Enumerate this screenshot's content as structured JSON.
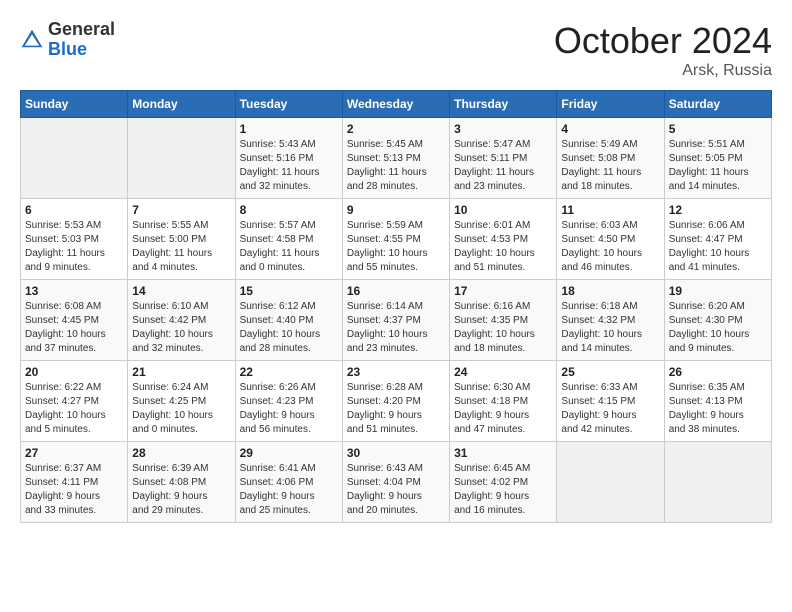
{
  "header": {
    "logo_general": "General",
    "logo_blue": "Blue",
    "month": "October 2024",
    "location": "Arsk, Russia"
  },
  "weekdays": [
    "Sunday",
    "Monday",
    "Tuesday",
    "Wednesday",
    "Thursday",
    "Friday",
    "Saturday"
  ],
  "weeks": [
    [
      {
        "day": "",
        "detail": ""
      },
      {
        "day": "",
        "detail": ""
      },
      {
        "day": "1",
        "detail": "Sunrise: 5:43 AM\nSunset: 5:16 PM\nDaylight: 11 hours\nand 32 minutes."
      },
      {
        "day": "2",
        "detail": "Sunrise: 5:45 AM\nSunset: 5:13 PM\nDaylight: 11 hours\nand 28 minutes."
      },
      {
        "day": "3",
        "detail": "Sunrise: 5:47 AM\nSunset: 5:11 PM\nDaylight: 11 hours\nand 23 minutes."
      },
      {
        "day": "4",
        "detail": "Sunrise: 5:49 AM\nSunset: 5:08 PM\nDaylight: 11 hours\nand 18 minutes."
      },
      {
        "day": "5",
        "detail": "Sunrise: 5:51 AM\nSunset: 5:05 PM\nDaylight: 11 hours\nand 14 minutes."
      }
    ],
    [
      {
        "day": "6",
        "detail": "Sunrise: 5:53 AM\nSunset: 5:03 PM\nDaylight: 11 hours\nand 9 minutes."
      },
      {
        "day": "7",
        "detail": "Sunrise: 5:55 AM\nSunset: 5:00 PM\nDaylight: 11 hours\nand 4 minutes."
      },
      {
        "day": "8",
        "detail": "Sunrise: 5:57 AM\nSunset: 4:58 PM\nDaylight: 11 hours\nand 0 minutes."
      },
      {
        "day": "9",
        "detail": "Sunrise: 5:59 AM\nSunset: 4:55 PM\nDaylight: 10 hours\nand 55 minutes."
      },
      {
        "day": "10",
        "detail": "Sunrise: 6:01 AM\nSunset: 4:53 PM\nDaylight: 10 hours\nand 51 minutes."
      },
      {
        "day": "11",
        "detail": "Sunrise: 6:03 AM\nSunset: 4:50 PM\nDaylight: 10 hours\nand 46 minutes."
      },
      {
        "day": "12",
        "detail": "Sunrise: 6:06 AM\nSunset: 4:47 PM\nDaylight: 10 hours\nand 41 minutes."
      }
    ],
    [
      {
        "day": "13",
        "detail": "Sunrise: 6:08 AM\nSunset: 4:45 PM\nDaylight: 10 hours\nand 37 minutes."
      },
      {
        "day": "14",
        "detail": "Sunrise: 6:10 AM\nSunset: 4:42 PM\nDaylight: 10 hours\nand 32 minutes."
      },
      {
        "day": "15",
        "detail": "Sunrise: 6:12 AM\nSunset: 4:40 PM\nDaylight: 10 hours\nand 28 minutes."
      },
      {
        "day": "16",
        "detail": "Sunrise: 6:14 AM\nSunset: 4:37 PM\nDaylight: 10 hours\nand 23 minutes."
      },
      {
        "day": "17",
        "detail": "Sunrise: 6:16 AM\nSunset: 4:35 PM\nDaylight: 10 hours\nand 18 minutes."
      },
      {
        "day": "18",
        "detail": "Sunrise: 6:18 AM\nSunset: 4:32 PM\nDaylight: 10 hours\nand 14 minutes."
      },
      {
        "day": "19",
        "detail": "Sunrise: 6:20 AM\nSunset: 4:30 PM\nDaylight: 10 hours\nand 9 minutes."
      }
    ],
    [
      {
        "day": "20",
        "detail": "Sunrise: 6:22 AM\nSunset: 4:27 PM\nDaylight: 10 hours\nand 5 minutes."
      },
      {
        "day": "21",
        "detail": "Sunrise: 6:24 AM\nSunset: 4:25 PM\nDaylight: 10 hours\nand 0 minutes."
      },
      {
        "day": "22",
        "detail": "Sunrise: 6:26 AM\nSunset: 4:23 PM\nDaylight: 9 hours\nand 56 minutes."
      },
      {
        "day": "23",
        "detail": "Sunrise: 6:28 AM\nSunset: 4:20 PM\nDaylight: 9 hours\nand 51 minutes."
      },
      {
        "day": "24",
        "detail": "Sunrise: 6:30 AM\nSunset: 4:18 PM\nDaylight: 9 hours\nand 47 minutes."
      },
      {
        "day": "25",
        "detail": "Sunrise: 6:33 AM\nSunset: 4:15 PM\nDaylight: 9 hours\nand 42 minutes."
      },
      {
        "day": "26",
        "detail": "Sunrise: 6:35 AM\nSunset: 4:13 PM\nDaylight: 9 hours\nand 38 minutes."
      }
    ],
    [
      {
        "day": "27",
        "detail": "Sunrise: 6:37 AM\nSunset: 4:11 PM\nDaylight: 9 hours\nand 33 minutes."
      },
      {
        "day": "28",
        "detail": "Sunrise: 6:39 AM\nSunset: 4:08 PM\nDaylight: 9 hours\nand 29 minutes."
      },
      {
        "day": "29",
        "detail": "Sunrise: 6:41 AM\nSunset: 4:06 PM\nDaylight: 9 hours\nand 25 minutes."
      },
      {
        "day": "30",
        "detail": "Sunrise: 6:43 AM\nSunset: 4:04 PM\nDaylight: 9 hours\nand 20 minutes."
      },
      {
        "day": "31",
        "detail": "Sunrise: 6:45 AM\nSunset: 4:02 PM\nDaylight: 9 hours\nand 16 minutes."
      },
      {
        "day": "",
        "detail": ""
      },
      {
        "day": "",
        "detail": ""
      }
    ]
  ]
}
